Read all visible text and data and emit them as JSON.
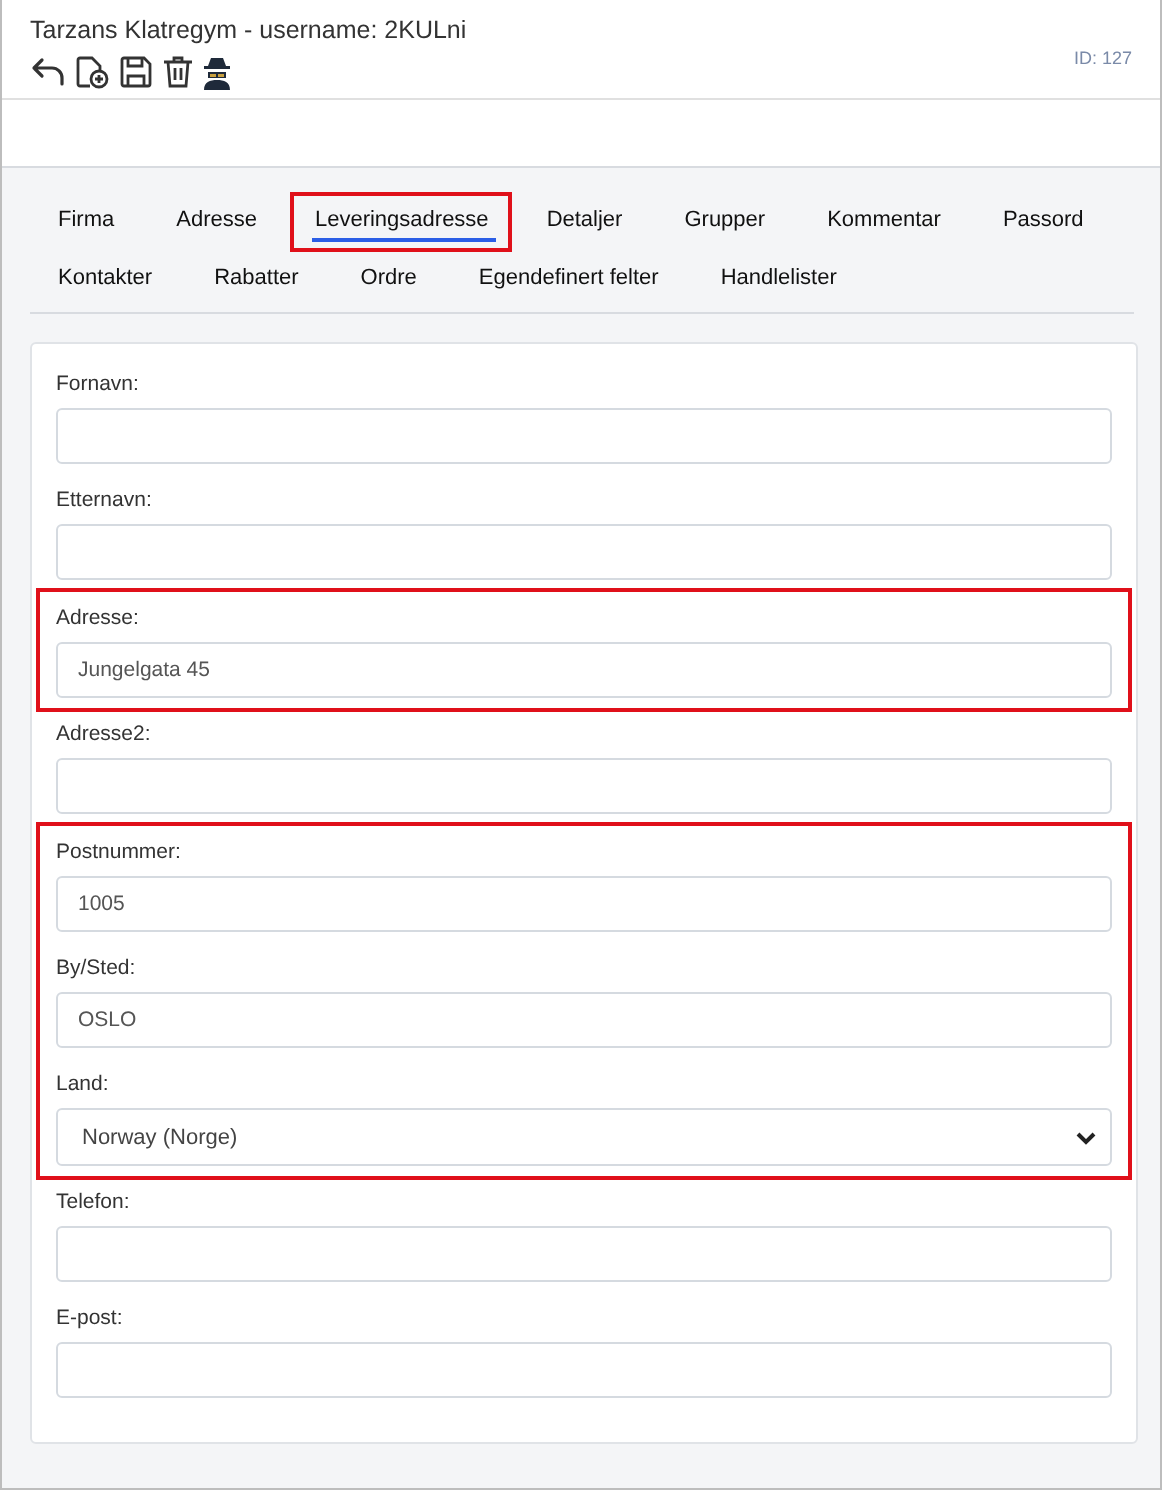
{
  "header": {
    "title": "Tarzans Klatregym - username: 2KULni",
    "id_label": "ID: 127"
  },
  "tab_rows": [
    [
      {
        "label": "Firma",
        "selected": false,
        "highlighted": false
      },
      {
        "label": "Adresse",
        "selected": false,
        "highlighted": false
      },
      {
        "label": "Leveringsadresse",
        "selected": true,
        "highlighted": true
      },
      {
        "label": "Detaljer",
        "selected": false,
        "highlighted": false
      },
      {
        "label": "Grupper",
        "selected": false,
        "highlighted": false
      },
      {
        "label": "Kommentar",
        "selected": false,
        "highlighted": false
      },
      {
        "label": "Passord",
        "selected": false,
        "highlighted": false
      }
    ],
    [
      {
        "label": "Kontakter",
        "selected": false,
        "highlighted": false
      },
      {
        "label": "Rabatter",
        "selected": false,
        "highlighted": false
      },
      {
        "label": "Ordre",
        "selected": false,
        "highlighted": false
      },
      {
        "label": "Egendefinert felter",
        "selected": false,
        "highlighted": false
      },
      {
        "label": "Handlelister",
        "selected": false,
        "highlighted": false
      }
    ]
  ],
  "sections": [
    {
      "highlighted": false,
      "fields": [
        {
          "label": "Fornavn:",
          "kind": "text"
        },
        {
          "label": "Etternavn:",
          "kind": "text"
        }
      ]
    },
    {
      "highlighted": true,
      "fields": [
        {
          "label": "Adresse:",
          "kind": "text",
          "value": "Jungelgata 45"
        }
      ]
    },
    {
      "highlighted": false,
      "fields": [
        {
          "label": "Adresse2:",
          "kind": "text"
        }
      ]
    },
    {
      "highlighted": true,
      "fields": [
        {
          "label": "Postnummer:",
          "kind": "text",
          "value": "1005"
        },
        {
          "label": "By/Sted:",
          "kind": "text",
          "value": "OSLO"
        },
        {
          "label": "Land:",
          "kind": "select",
          "value": "Norway (Norge)"
        }
      ]
    },
    {
      "highlighted": false,
      "fields": [
        {
          "label": "Telefon:",
          "kind": "text"
        },
        {
          "label": "E-post:",
          "kind": "text"
        }
      ]
    }
  ]
}
